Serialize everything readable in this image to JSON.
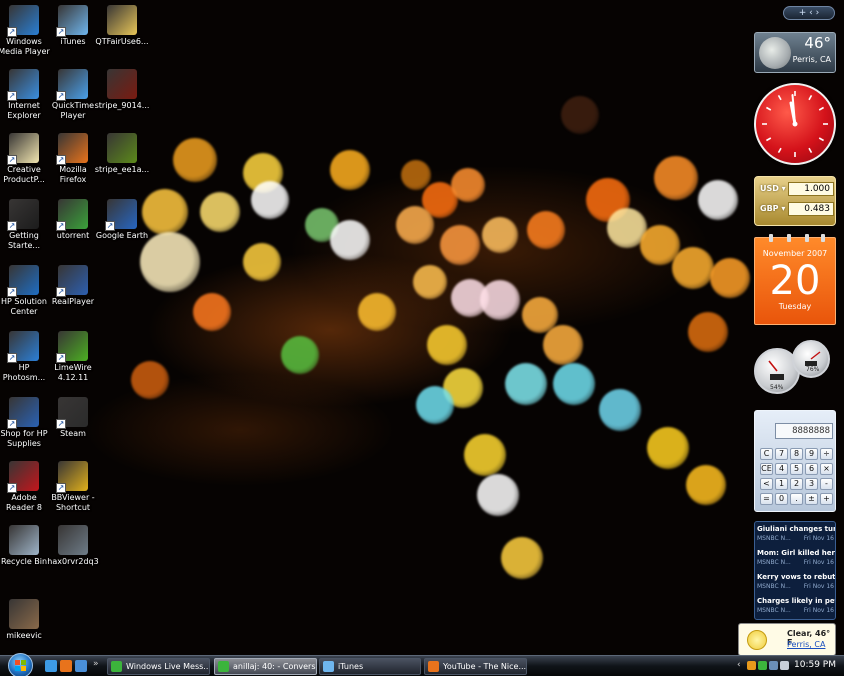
{
  "desktop_icons": [
    {
      "id": "wmp",
      "label": "Windows\nMedia Player",
      "icon": "windows-media-player-icon",
      "color": "#2a7fd4"
    },
    {
      "id": "itunes",
      "label": "iTunes",
      "icon": "itunes-icon",
      "color": "#6fb6ee"
    },
    {
      "id": "qtfair",
      "label": "QTFairUse6...",
      "icon": "folder-icon",
      "color": "#e8c658"
    },
    {
      "id": "ie",
      "label": "Internet\nExplorer",
      "icon": "internet-explorer-icon",
      "color": "#3b8fe0"
    },
    {
      "id": "quicktime",
      "label": "QuickTime\nPlayer",
      "icon": "quicktime-icon",
      "color": "#4aa0ea"
    },
    {
      "id": "stripe1",
      "label": "stripe_9014...",
      "icon": "image-file-icon",
      "color": "#7a1a10"
    },
    {
      "id": "creative",
      "label": "Creative\nProductP...",
      "icon": "pencil-icon",
      "color": "#f2e6b0"
    },
    {
      "id": "firefox",
      "label": "Mozilla\nFirefox",
      "icon": "firefox-icon",
      "color": "#e8731c"
    },
    {
      "id": "stripe2",
      "label": "stripe_ee1a...",
      "icon": "image-file-icon",
      "color": "#5c8a1a"
    },
    {
      "id": "getting",
      "label": "Getting\nStarte...",
      "icon": "getting-started-icon",
      "color": "#1c1c1c"
    },
    {
      "id": "utorrent",
      "label": "utorrent",
      "icon": "utorrent-icon",
      "color": "#3aa13a"
    },
    {
      "id": "gearth",
      "label": "Google Earth",
      "icon": "google-earth-icon",
      "color": "#2766c2"
    },
    {
      "id": "hpsol",
      "label": "HP Solution\nCenter",
      "icon": "hp-solution-center-icon",
      "color": "#1f6dc2"
    },
    {
      "id": "realplayer",
      "label": "RealPlayer",
      "icon": "realplayer-icon",
      "color": "#2d5fb0"
    },
    {
      "id": "hpphoto",
      "label": "HP\nPhotosm...",
      "icon": "hp-photosmart-icon",
      "color": "#2c7fd6"
    },
    {
      "id": "limewire",
      "label": "LimeWire\n4.12.11",
      "icon": "limewire-icon",
      "color": "#4caf22"
    },
    {
      "id": "shophp",
      "label": "Shop for HP\nSupplies",
      "icon": "printer-icon",
      "color": "#2a62b5"
    },
    {
      "id": "steam",
      "label": "Steam",
      "icon": "steam-icon",
      "color": "#2b2b2b"
    },
    {
      "id": "adobe",
      "label": "Adobe\nReader 8",
      "icon": "adobe-reader-icon",
      "color": "#c4161c"
    },
    {
      "id": "bbviewer",
      "label": "BBViewer -\nShortcut",
      "icon": "tv-icon",
      "color": "#e0b01c"
    },
    {
      "id": "recycle",
      "label": "Recycle Bin",
      "icon": "recycle-bin-icon",
      "color": "#9eb4c8"
    },
    {
      "id": "hax",
      "label": "hax0rvr2dq3",
      "icon": "screenshot-file-icon",
      "color": "#6e7c88"
    },
    {
      "id": "mikeevic",
      "label": "mikeevic",
      "icon": "image-file-icon",
      "color": "#8a6a4a"
    }
  ],
  "sidebar": {
    "control_label": "+ ‹ ›"
  },
  "weather": {
    "temp": "46°",
    "location": "Perris, CA"
  },
  "clock": {
    "time": "11:57"
  },
  "currency": {
    "rows": [
      {
        "code": "USD ▾",
        "value": "1.000"
      },
      {
        "code": "GBP ▾",
        "value": "0.483"
      }
    ]
  },
  "calendar": {
    "month": "November 2007",
    "day": "20",
    "weekday": "Tuesday"
  },
  "meters": {
    "cpu": "54%",
    "memory": "76%"
  },
  "calculator": {
    "display": "8888888",
    "keys": [
      [
        "C",
        "7",
        "8",
        "9",
        "÷"
      ],
      [
        "CE",
        "4",
        "5",
        "6",
        "×"
      ],
      [
        "<",
        "1",
        "2",
        "3",
        "-"
      ],
      [
        "=",
        "0",
        ".",
        "±",
        "+"
      ]
    ]
  },
  "news": {
    "items": [
      {
        "headline": "Giuliani changes tun...",
        "source": "MSNBC N...",
        "date": "Fri Nov 16"
      },
      {
        "headline": "Mom: Girl killed hers...",
        "source": "MSNBC N...",
        "date": "Fri Nov 16"
      },
      {
        "headline": "Kerry vows to rebut ...",
        "source": "MSNBC N...",
        "date": "Fri Nov 16"
      },
      {
        "headline": "Charges likely in pet ...",
        "source": "MSNBC N...",
        "date": "Fri Nov 16"
      }
    ]
  },
  "weather_toast": {
    "title": "Clear, 46° F",
    "location": "Perris, CA"
  },
  "taskbar": {
    "buttons": [
      {
        "label": "Windows Live Mess...",
        "color": "#3cb43c",
        "active": false
      },
      {
        "label": "anillaj: 40: - Convers...",
        "color": "#3cb43c",
        "active": true
      },
      {
        "label": "iTunes",
        "color": "#6fb6ee",
        "active": false
      },
      {
        "label": "YouTube - The Nice...",
        "color": "#e8731c",
        "active": false
      }
    ],
    "clock": "10:59 PM"
  }
}
